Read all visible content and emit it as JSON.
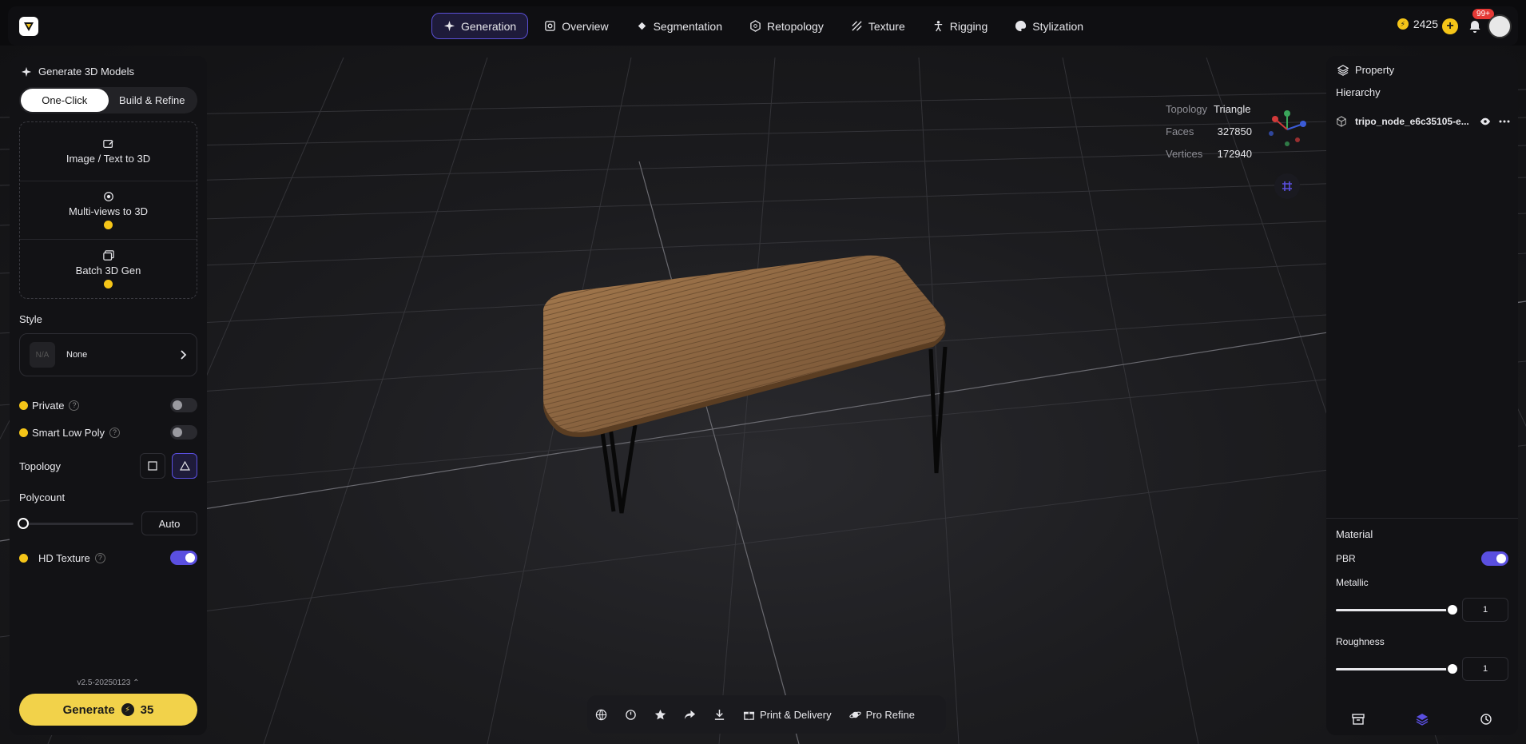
{
  "topbar": {
    "tabs": [
      {
        "label": "Generation",
        "icon": "sparkle-icon",
        "active": true
      },
      {
        "label": "Overview",
        "icon": "scan-icon"
      },
      {
        "label": "Segmentation",
        "icon": "pieces-icon"
      },
      {
        "label": "Retopology",
        "icon": "mesh-icon"
      },
      {
        "label": "Texture",
        "icon": "texture-icon"
      },
      {
        "label": "Rigging",
        "icon": "figure-icon"
      },
      {
        "label": "Stylization",
        "icon": "palette-icon"
      }
    ],
    "credits": "2425",
    "notification_badge": "99+"
  },
  "viewport": {
    "stats": [
      {
        "key": "Topology",
        "value": "Triangle"
      },
      {
        "key": "Faces",
        "value": "327850"
      },
      {
        "key": "Vertices",
        "value": "172940"
      }
    ]
  },
  "left": {
    "title": "Generate 3D Models",
    "segments": [
      "One-Click",
      "Build & Refine"
    ],
    "modes": [
      {
        "label": "Image / Text to 3D",
        "premium": false
      },
      {
        "label": "Multi-views to 3D",
        "premium": true
      },
      {
        "label": "Batch 3D Gen",
        "premium": true
      }
    ],
    "style_label": "Style",
    "style_thumb": "N/A",
    "style_value": "None",
    "options": [
      {
        "label": "Private",
        "on": false
      },
      {
        "label": "Smart Low Poly",
        "on": false
      }
    ],
    "topology_label": "Topology",
    "polycount_label": "Polycount",
    "polycount_value": "Auto",
    "polycount_level": 0,
    "hd_texture_label": "HD Texture",
    "hd_texture_on": true,
    "version": "v2.5-20250123",
    "generate_label": "Generate",
    "generate_cost": "35"
  },
  "right": {
    "title": "Property",
    "hierarchy": "Hierarchy",
    "node_name": "tripo_node_e6c35105-e...",
    "material_title": "Material",
    "pbr_label": "PBR",
    "pbr_on": true,
    "metallic_label": "Metallic",
    "metallic_value": "1",
    "roughness_label": "Roughness",
    "roughness_value": "1"
  },
  "bottombar": {
    "print_label": "Print & Delivery",
    "refine_label": "Pro Refine"
  },
  "colors": {
    "accent": "#5a4fe0",
    "gold": "#f2d24a",
    "panel": "#121215"
  }
}
